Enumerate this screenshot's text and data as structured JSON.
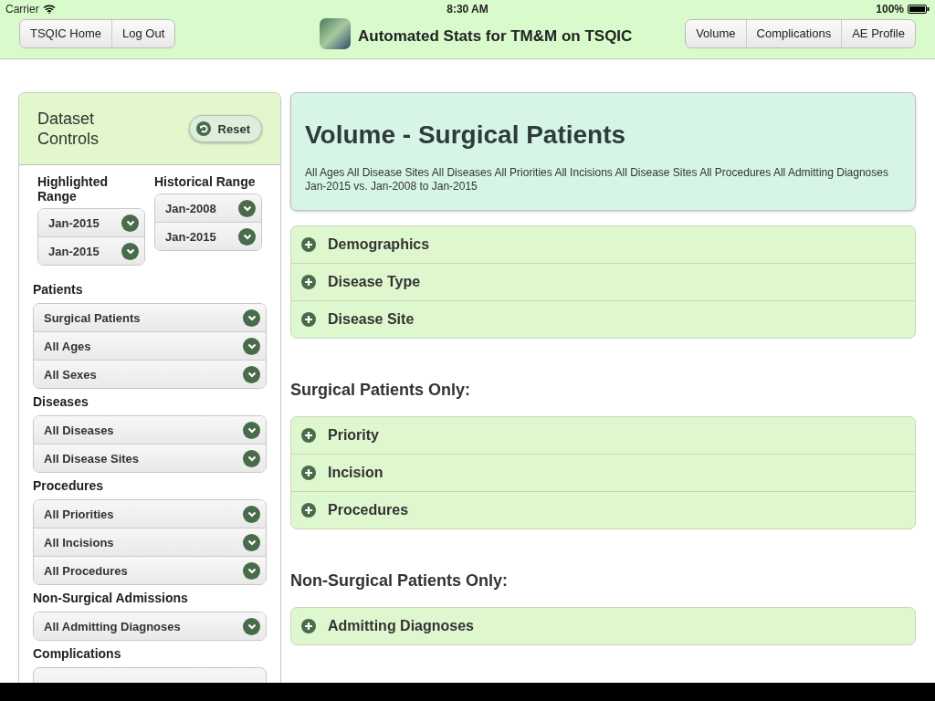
{
  "status_bar": {
    "carrier": "Carrier",
    "time": "8:30 AM",
    "battery": "100%"
  },
  "header": {
    "left_buttons": [
      "TSQIC Home",
      "Log Out"
    ],
    "title": "Automated Stats for TM&M on TSQIC",
    "right_buttons": [
      "Volume",
      "Complications",
      "AE Profile"
    ]
  },
  "sidebar": {
    "title": "Dataset Controls",
    "reset": "Reset",
    "ranges": [
      {
        "label": "Highlighted Range",
        "selects": [
          "Jan-2015",
          "Jan-2015"
        ]
      },
      {
        "label": "Historical Range",
        "selects": [
          "Jan-2008",
          "Jan-2015"
        ]
      }
    ],
    "groups": [
      {
        "label": "Patients",
        "selects": [
          "Surgical Patients",
          "All Ages",
          "All Sexes"
        ]
      },
      {
        "label": "Diseases",
        "selects": [
          "All Diseases",
          "All Disease Sites"
        ]
      },
      {
        "label": "Procedures",
        "selects": [
          "All Priorities",
          "All Incisions",
          "All Procedures"
        ]
      },
      {
        "label": "Non-Surgical Admissions",
        "selects": [
          "All Admitting Diagnoses"
        ]
      },
      {
        "label": "Complications"
      }
    ]
  },
  "report": {
    "title": "Volume - Surgical Patients",
    "filters": "All Ages All Disease Sites All Diseases All Priorities All Incisions All Disease Sites All Procedures All Admitting Diagnoses",
    "range": "Jan-2015 vs. Jan-2008 to Jan-2015"
  },
  "sections": [
    {
      "items": [
        "Demographics",
        "Disease Type",
        "Disease Site"
      ]
    },
    {
      "heading": "Surgical Patients Only:",
      "items": [
        "Priority",
        "Incision",
        "Procedures"
      ]
    },
    {
      "heading": "Non-Surgical Patients Only:",
      "items": [
        "Admitting Diagnoses"
      ]
    }
  ]
}
